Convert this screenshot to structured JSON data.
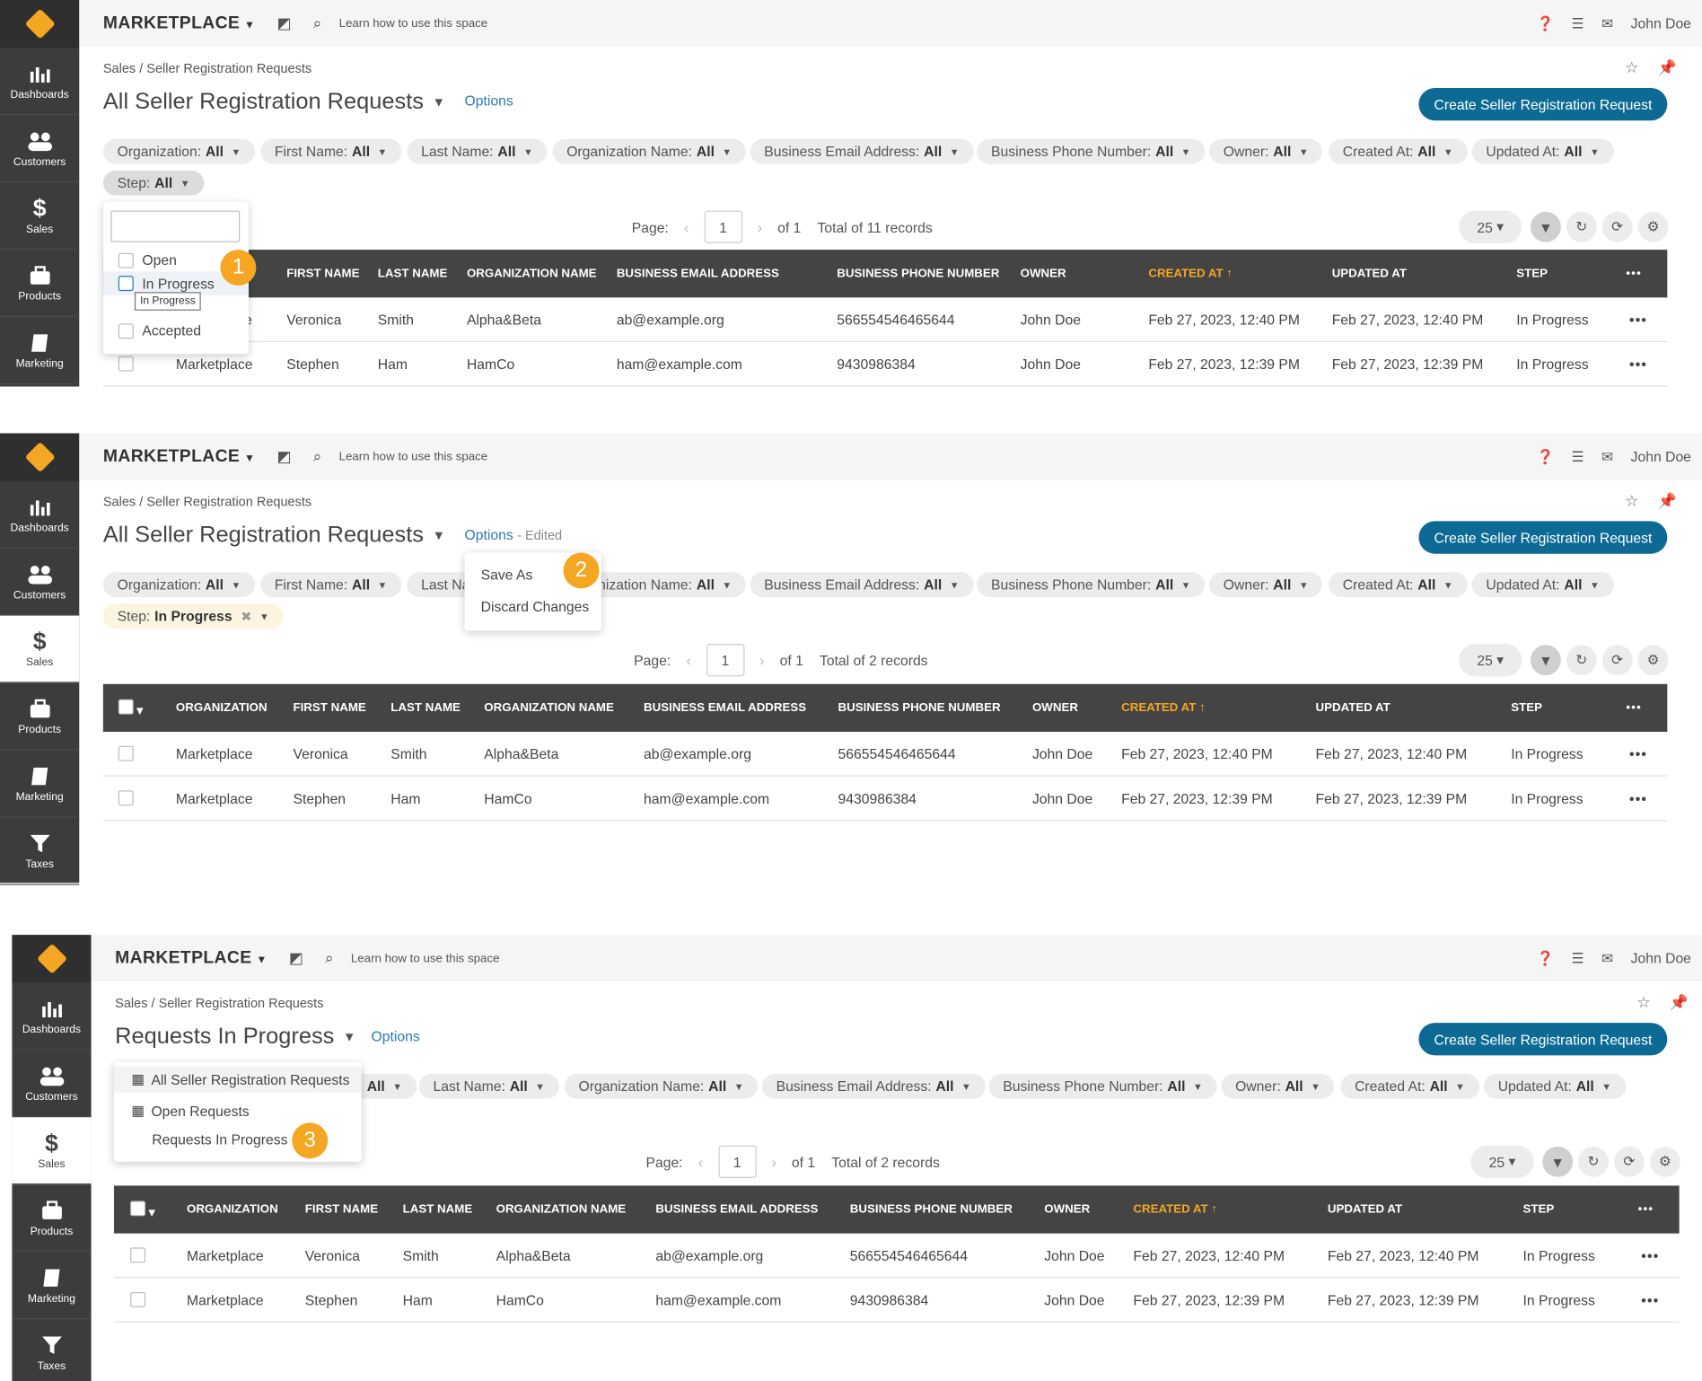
{
  "topbar": {
    "brand": "MARKETPLACE",
    "learn": "Learn how to use this space",
    "user": "John Doe"
  },
  "breadcrumb": "Sales / Seller Registration Requests",
  "title_all": "All Seller Registration Requests",
  "title_inprog": "Requests In Progress",
  "options": "Options",
  "edited": "- Edited",
  "create_label": "Create Seller Registration Request",
  "nav": {
    "dashboards": "Dashboards",
    "customers": "Customers",
    "sales": "Sales",
    "products": "Products",
    "marketing": "Marketing",
    "taxes": "Taxes"
  },
  "filters": {
    "organization": "Organization:",
    "first_name": "First Name:",
    "last_name": "Last Name:",
    "org_name": "Organization Name:",
    "email": "Business Email Address:",
    "phone": "Business Phone Number:",
    "owner": "Owner:",
    "created": "Created At:",
    "updated": "Updated At:",
    "step": "Step:",
    "all": "All",
    "in_progress": "In Progress"
  },
  "pager": {
    "page": "Page:",
    "num": "1",
    "of": "of 1",
    "total_11": "Total of 11 records",
    "total_2": "Total of 2 records",
    "per_page": "25"
  },
  "columns": {
    "organization": "ORGANIZATION",
    "first_name": "FIRST NAME",
    "last_name": "LAST NAME",
    "org_name": "ORGANIZATION NAME",
    "email": "BUSINESS EMAIL ADDRESS",
    "phone": "BUSINESS PHONE NUMBER",
    "owner": "OWNER",
    "created": "CREATED AT",
    "updated": "UPDATED AT",
    "step": "STEP"
  },
  "rows": [
    {
      "org": "Marketplace",
      "first": "Veronica",
      "last": "Smith",
      "orgname": "Alpha&Beta",
      "email": "ab@example.org",
      "phone": "566554546465644",
      "owner": "John Doe",
      "created": "Feb 27, 2023, 12:40 PM",
      "updated": "Feb 27, 2023, 12:40 PM",
      "step": "In Progress"
    },
    {
      "org": "Marketplace",
      "first": "Stephen",
      "last": "Ham",
      "orgname": "HamCo",
      "email": "ham@example.com",
      "phone": "9430986384",
      "owner": "John Doe",
      "created": "Feb 27, 2023, 12:39 PM",
      "updated": "Feb 27, 2023, 12:39 PM",
      "step": "In Progress"
    }
  ],
  "row_org_partial": "e",
  "step_dropdown": {
    "open": "Open",
    "in_progress": "In Progress",
    "accepted": "Accepted",
    "tooltip": "In Progress"
  },
  "options_menu": {
    "save_as": "Save As",
    "discard": "Discard Changes"
  },
  "views_menu": [
    "All Seller Registration Requests",
    "Open Requests",
    "Requests In Progress"
  ],
  "badges": [
    "1",
    "2",
    "3"
  ],
  "colors": {
    "sidebar": "#3c3c3c",
    "accent": "#f5a623",
    "primary": "#0c6a95",
    "header": "#444444"
  }
}
